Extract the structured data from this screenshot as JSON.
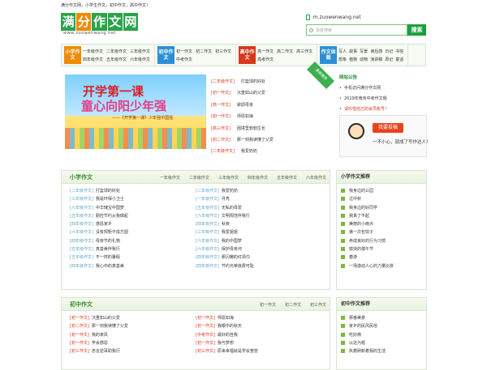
{
  "topline": "满分作文网，小学生作文，初中作文，高中作文！",
  "logo": {
    "chars": [
      "满",
      "分",
      "作",
      "文",
      "网"
    ],
    "colors": [
      "#2aa34a",
      "#f08a00",
      "#2aa34a",
      "#2aa34a",
      "#2aa34a"
    ],
    "url": "www.zuowenwang.net"
  },
  "mobile": "m.zuowenwang.net",
  "search": {
    "placeholder": "百度搜索",
    "button": "搜索"
  },
  "nav": {
    "primary": {
      "label": "小学作文",
      "color": "#f08a00",
      "links": [
        "一年级作文",
        "二年级作文",
        "三年级作文",
        "四年级作文",
        "五年级作文",
        "六年级作文"
      ]
    },
    "middle": {
      "label": "初中作文",
      "color": "#2c8fd6",
      "links": [
        "初一作文",
        "初二作文",
        "初三作文",
        "中考作文"
      ]
    },
    "high": {
      "label": "高中作文",
      "color": "#d9361a",
      "links": [
        "高一作文",
        "高二作文",
        "高三作文",
        "高考作文"
      ]
    },
    "genre": {
      "label": "作文体裁",
      "color": "#2c8fd6",
      "links": [
        "写人",
        "叙事",
        "写景",
        "读后感",
        "日记",
        "书信",
        "想象",
        "植物",
        "动物",
        "演讲稿",
        "周记",
        "童话"
      ]
    }
  },
  "banner": {
    "title1": "开学第一课",
    "title2": "童心向阳少年强",
    "sub": "——《开学第一课》少年强中国强"
  },
  "top_list": [
    {
      "tag": "[二年级作文]",
      "text": "打篮球的好处"
    },
    {
      "tag": "[初一作文]",
      "text": "沉重如山的父爱"
    },
    {
      "tag": "[高一作文]",
      "text": "歌颂母亲"
    },
    {
      "tag": "[初一作文]",
      "text": "师恩如海"
    },
    {
      "tag": "[高三作文]",
      "text": "困境里勃勃生长"
    },
    {
      "tag": "[初二作文]",
      "text": "那一刻我读懂了父爱"
    },
    {
      "tag": "[二年级作文]",
      "text": "我爱奶奶"
    }
  ],
  "ribbon": "最新推荐",
  "notice": {
    "title": "网站公告",
    "items": [
      {
        "text": "手机访问满分作文网",
        "hl": false
      },
      {
        "text": "2019年南京中考作文题",
        "hl": false
      },
      {
        "text": "请珍惜自己的会员账号！",
        "hl": true
      }
    ]
  },
  "submit": {
    "button": "我要投稿",
    "caption": "一不小心，就成了写作达人！"
  },
  "primary_panel": {
    "title": "小学作文",
    "tabs": [
      "一年级作文",
      "二年级作文",
      "三年级作文",
      "四年级作文",
      "五年级作文",
      "六年级作文"
    ],
    "left": [
      {
        "tag": "[二年级作文]",
        "text": "打篮球的好处"
      },
      {
        "tag": "[三年级作文]",
        "text": "我是环保小卫士"
      },
      {
        "tag": "[六年级作文]",
        "text": "中华瑰宝中国梦"
      },
      {
        "tag": "[五年级作文]",
        "text": "勤俭节约从我做起"
      },
      {
        "tag": "[四年级作文]",
        "text": "感恩家乡"
      },
      {
        "tag": "[六年级作文]",
        "text": "没有规矩不成方圆"
      },
      {
        "tag": "[四年级作文]",
        "text": "母亲节的礼物"
      },
      {
        "tag": "[五年级作文]",
        "text": "真善美伴我行"
      },
      {
        "tag": "[五年级作文]",
        "text": "不一样的暑假"
      },
      {
        "tag": "[四年级作文]",
        "text": "我心中的真善美"
      }
    ],
    "right": [
      {
        "tag": "[二年级作文]",
        "text": "我爱奶奶"
      },
      {
        "tag": "[一年级作文]",
        "text": "月亮"
      },
      {
        "tag": "[五年级作文]",
        "text": "无私的母爱"
      },
      {
        "tag": "[六年级作文]",
        "text": "文明规范伴我行"
      },
      {
        "tag": "[四年级作文]",
        "text": "秋夜"
      },
      {
        "tag": "[三年级作文]",
        "text": "我爱姐姐"
      },
      {
        "tag": "[六年级作文]",
        "text": "我的中国梦"
      },
      {
        "tag": "[六年级作文]",
        "text": "保护母亲河"
      },
      {
        "tag": "[四年级作文]",
        "text": "那闪耀的红领巾"
      },
      {
        "tag": "[四年级作文]",
        "text": "节约光荣浪费可耻"
      }
    ]
  },
  "primary_side": {
    "title": "小学作文推荐",
    "items": [
      "我身边的公园",
      "过中秋",
      "我身边的好同学",
      "我真了不起",
      "美丽的小雨点",
      "第一次包饺子",
      "养成良好的行为习惯",
      "愉快的端午节",
      "春游",
      "一场激动人心的力量比拼"
    ]
  },
  "middle_panel": {
    "title": "初中作文",
    "tabs": [
      "初一作文",
      "初二作文",
      "初三作文"
    ],
    "left": [
      {
        "tag": "[初一作文]",
        "text": "沉重如山的父爱"
      },
      {
        "tag": "[初二作文]",
        "text": "那一刻我读懂了父爱"
      },
      {
        "tag": "[初一作文]",
        "text": "我的家风"
      },
      {
        "tag": "[初一作文]",
        "text": "学会感恩"
      },
      {
        "tag": "[初三作文]",
        "text": "忠言逆耳助我行"
      }
    ],
    "right": [
      {
        "tag": "[初一作文]",
        "text": "师恩如海"
      },
      {
        "tag": "[初一作文]",
        "text": "我眼中的秋天"
      },
      {
        "tag": "[中考作文]",
        "text": "最好的自我"
      },
      {
        "tag": "[初一作文]",
        "text": "我与梦想"
      },
      {
        "tag": "[初三作文]",
        "text": "原来幸福就是学会宽容"
      }
    ]
  },
  "middle_side": {
    "title": "初中作文推荐",
    "items": [
      "那番美景",
      "家乡的民风民俗",
      "吃好斋",
      "以这为题",
      "执着刷新着我的生活"
    ]
  }
}
